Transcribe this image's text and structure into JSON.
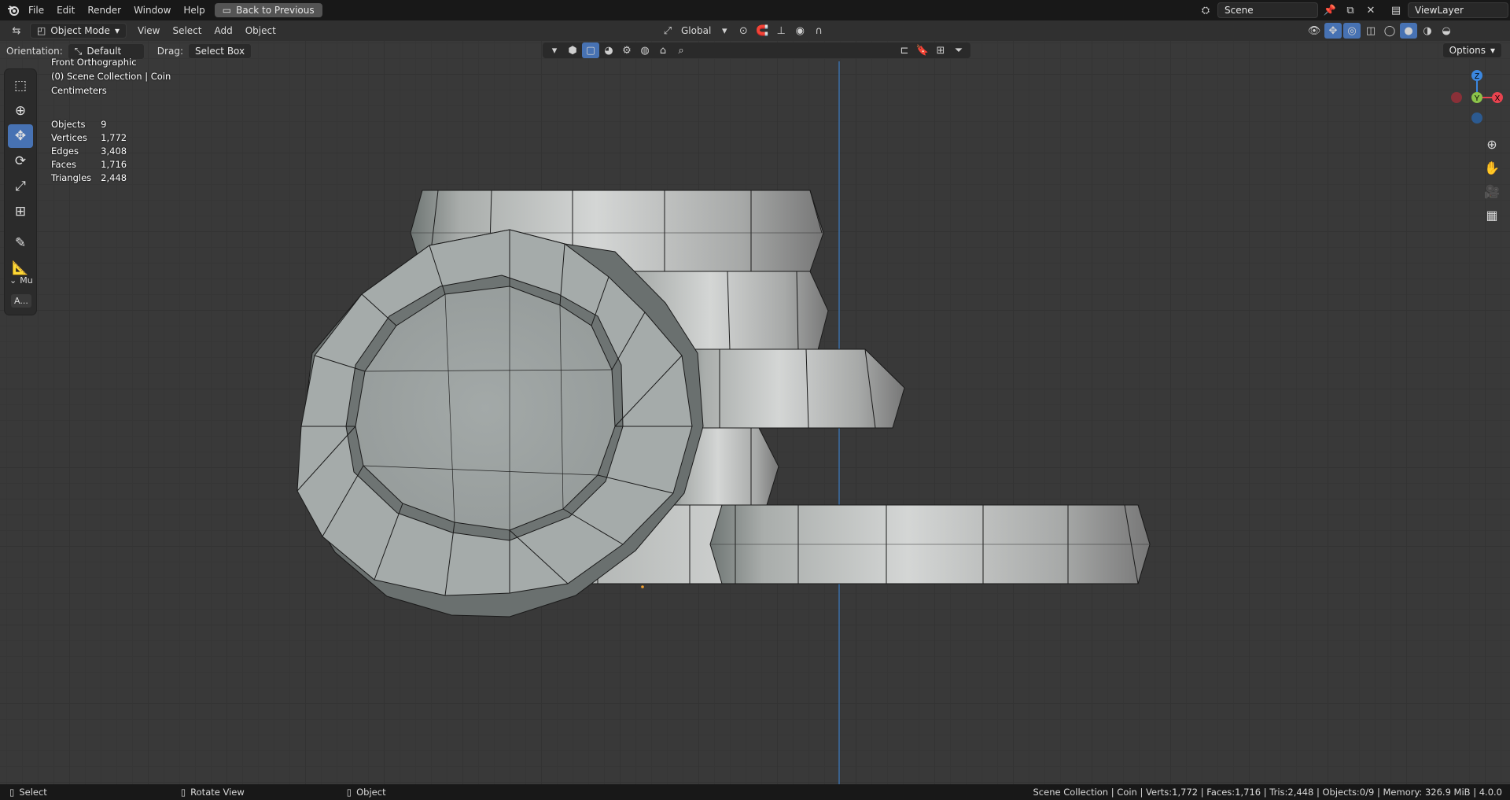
{
  "topbar": {
    "menus": [
      "File",
      "Edit",
      "Render",
      "Window",
      "Help"
    ],
    "back_button": "Back to Previous",
    "scene_label": "Scene",
    "viewlayer_label": "ViewLayer"
  },
  "header": {
    "mode": "Object Mode",
    "menus": [
      "View",
      "Select",
      "Add",
      "Object"
    ],
    "transform_orientation": "Global",
    "options_label": "Options"
  },
  "toolheader": {
    "orientation_label": "Orientation:",
    "orientation_value": "Default",
    "drag_label": "Drag:",
    "drag_value": "Select Box"
  },
  "overlay": {
    "view_name": "Front Orthographic",
    "collection": "(0) Scene Collection | Coin",
    "units": "Centimeters",
    "stats": [
      {
        "label": "Objects",
        "value": "9"
      },
      {
        "label": "Vertices",
        "value": "1,772"
      },
      {
        "label": "Edges",
        "value": "3,408"
      },
      {
        "label": "Faces",
        "value": "1,716"
      },
      {
        "label": "Triangles",
        "value": "2,448"
      }
    ]
  },
  "toolbar": {
    "panel_label": "Mu",
    "panel_button": "A..."
  },
  "gizmo": {
    "z": "Z",
    "y": "Y",
    "x": "X"
  },
  "statusbar": {
    "select": "Select",
    "rotate": "Rotate View",
    "object": "Object",
    "info": "Scene Collection | Coin | Verts:1,772 | Faces:1,716 | Tris:2,448 | Objects:0/9 | Memory: 326.9 MiB | 4.0.0"
  },
  "colors": {
    "accent": "#4772b3",
    "axis_x": "#e8434f",
    "axis_y": "#8bc34a",
    "axis_z": "#3b87e0"
  }
}
